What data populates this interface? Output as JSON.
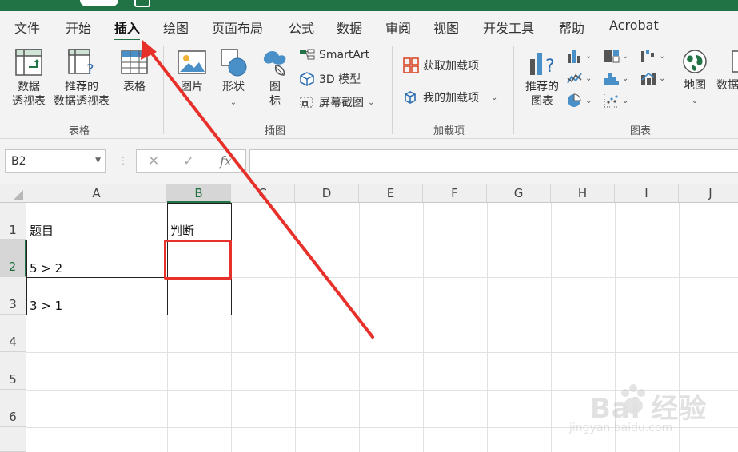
{
  "menu": {
    "tabs": [
      {
        "label": "文件"
      },
      {
        "label": "开始"
      },
      {
        "label": "插入"
      },
      {
        "label": "绘图"
      },
      {
        "label": "页面布局"
      },
      {
        "label": "公式"
      },
      {
        "label": "数据"
      },
      {
        "label": "审阅"
      },
      {
        "label": "视图"
      },
      {
        "label": "开发工具"
      },
      {
        "label": "帮助"
      },
      {
        "label": "Acrobat"
      }
    ],
    "active_tab": "插入"
  },
  "ribbon": {
    "tables_group": {
      "label": "表格",
      "pivot_table": "数据\n透视表",
      "pivot_table_l1": "数据",
      "pivot_table_l2": "透视表",
      "recommended_pivot_l1": "推荐的",
      "recommended_pivot_l2": "数据透视表",
      "table": "表格"
    },
    "illustrations_group": {
      "label": "插图",
      "pictures": "图片",
      "shapes": "形状",
      "icons_l1": "图",
      "icons_l2": "标",
      "smartart": "SmartArt",
      "model_3d": "3D 模型",
      "screenshot": "屏幕截图"
    },
    "addins_group": {
      "label": "加载项",
      "get_addins": "获取加载项",
      "my_addins": "我的加载项"
    },
    "charts_group": {
      "label": "图表",
      "recommended_charts_l1": "推荐的",
      "recommended_charts_l2": "图表",
      "maps": "地图",
      "pivot_chart_partial": "数据"
    }
  },
  "formula_bar": {
    "name_box": "B2",
    "fx_label": "fx",
    "cancel": "✕",
    "enter": "✓",
    "value": ""
  },
  "sheet": {
    "columns": [
      "A",
      "B",
      "C",
      "D",
      "E",
      "F",
      "G",
      "H",
      "I",
      "J"
    ],
    "rows": [
      "1",
      "2",
      "3",
      "4",
      "5",
      "6"
    ],
    "selected_cell": "B2",
    "cells": {
      "A1": "题目",
      "B1": "判断",
      "A2": "5 > 2",
      "B2": "",
      "A3": "3 > 1",
      "B3": ""
    }
  },
  "watermark": {
    "text": "Bai  经验",
    "url": "jingyan.baidu.com"
  },
  "colors": {
    "accent": "#217346",
    "highlight": "#e8302a"
  }
}
